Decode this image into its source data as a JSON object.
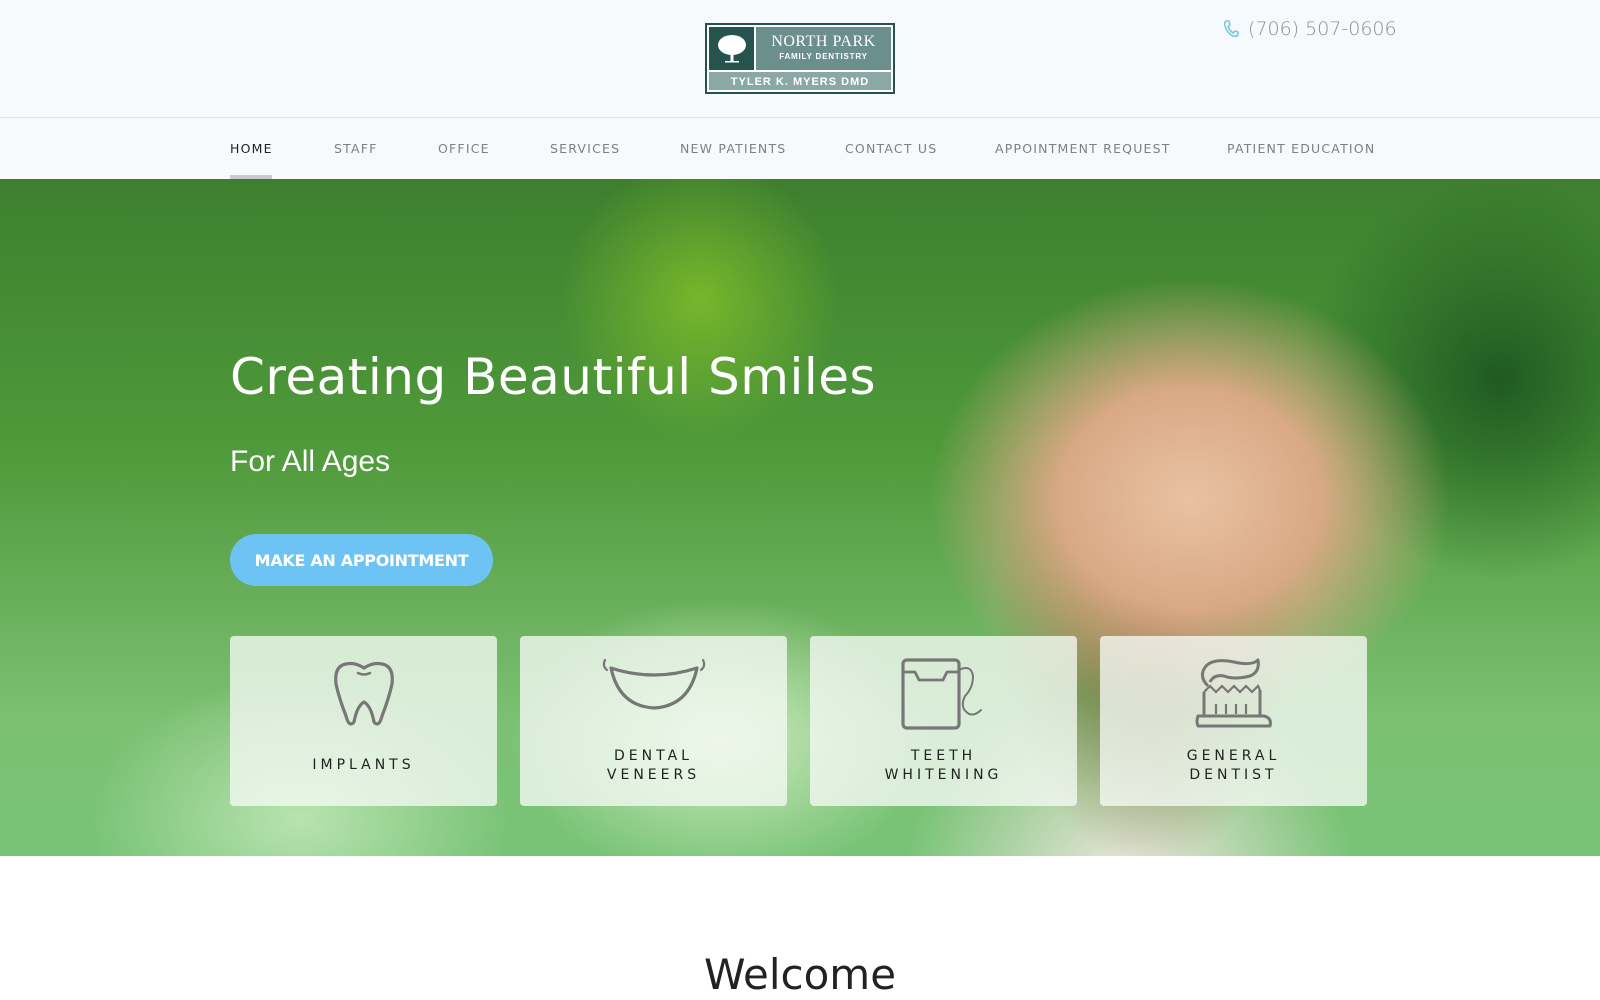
{
  "header": {
    "logo": {
      "name_line1": "NORTH PARK",
      "name_line2": "FAMILY DENTISTRY",
      "doctor": "TYLER K. MYERS DMD"
    },
    "phone": "(706) 507-0606"
  },
  "nav": {
    "items": [
      {
        "label": "HOME",
        "active": true
      },
      {
        "label": "STAFF"
      },
      {
        "label": "OFFICE"
      },
      {
        "label": "SERVICES"
      },
      {
        "label": "NEW PATIENTS"
      },
      {
        "label": "CONTACT US"
      },
      {
        "label": "APPOINTMENT REQUEST"
      },
      {
        "label": "PATIENT EDUCATION"
      }
    ]
  },
  "hero": {
    "title": "Creating Beautiful Smiles",
    "subtitle": "For All Ages",
    "cta_label": "MAKE AN APPOINTMENT",
    "services": [
      {
        "icon": "tooth-icon",
        "line1": "IMPLANTS",
        "line2": ""
      },
      {
        "icon": "smile-icon",
        "line1": "DENTAL",
        "line2": "VENEERS"
      },
      {
        "icon": "floss-icon",
        "line1": "TEETH",
        "line2": "WHITENING"
      },
      {
        "icon": "toothbrush-icon",
        "line1": "GENERAL",
        "line2": "DENTIST"
      }
    ]
  },
  "main": {
    "welcome": "Welcome"
  },
  "colors": {
    "accent": "#6ec3f5",
    "logo_dark": "#27534f",
    "logo_mid": "#6b8f8d",
    "phone_icon": "#7cc7e8"
  }
}
